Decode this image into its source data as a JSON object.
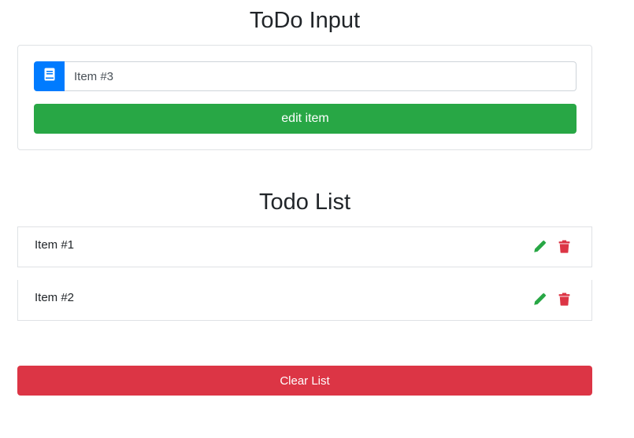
{
  "colors": {
    "primary": "#007bff",
    "success": "#28a745",
    "danger": "#dc3545",
    "text": "#212529",
    "border": "#dfe2e5"
  },
  "input_section": {
    "title": "ToDo Input",
    "addon_icon": "book-icon",
    "input_value": "Item #3",
    "submit_label": "edit item"
  },
  "list_section": {
    "title": "Todo List",
    "items": [
      {
        "label": "Item #1",
        "edit_icon": "pencil-icon",
        "delete_icon": "trash-icon"
      },
      {
        "label": "Item #2",
        "edit_icon": "pencil-icon",
        "delete_icon": "trash-icon"
      }
    ],
    "clear_label": "Clear List"
  }
}
